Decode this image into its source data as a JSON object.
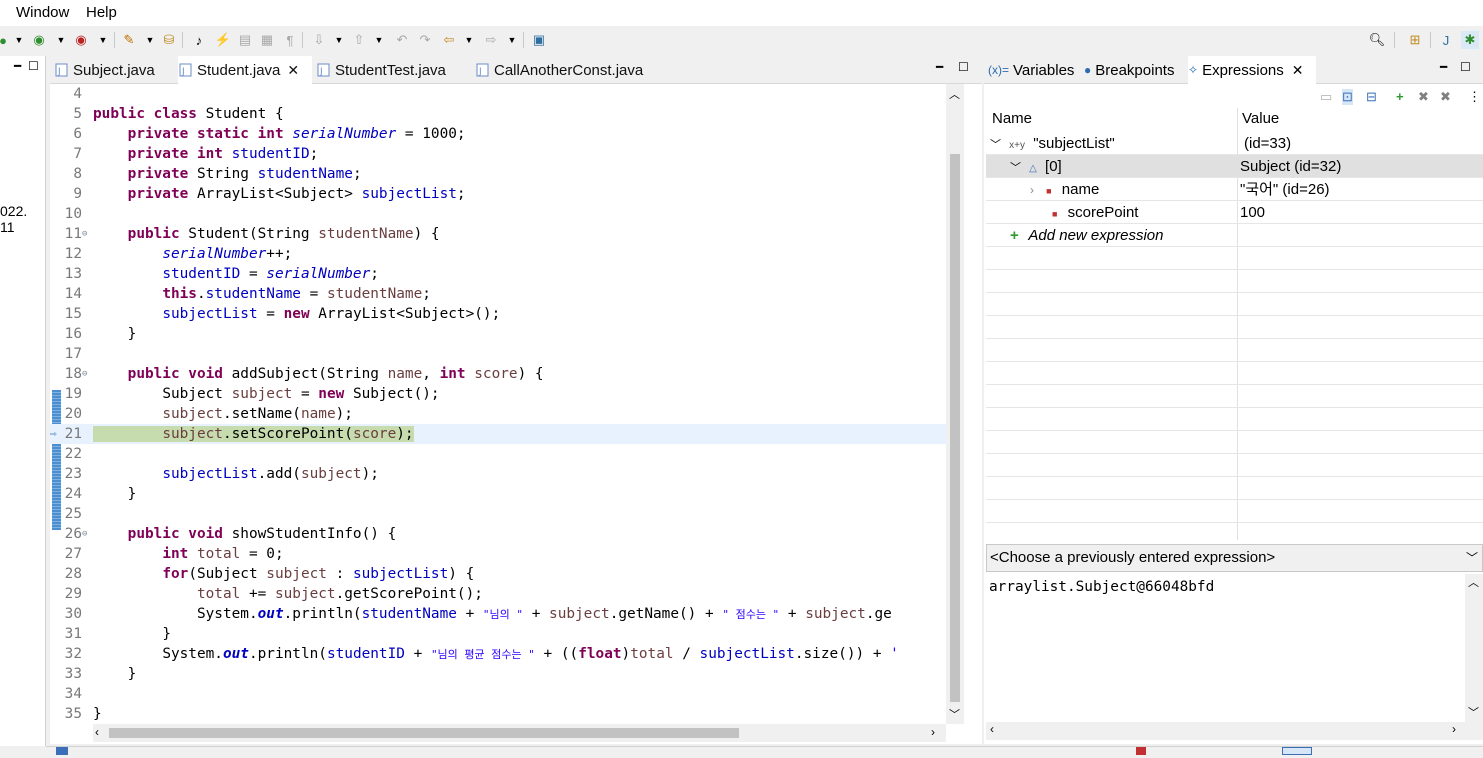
{
  "menu": {
    "items": [
      "Window",
      "Help"
    ]
  },
  "left_panel": {
    "date_fragment": "022. 11"
  },
  "editor": {
    "tabs": [
      {
        "label": "Subject.java",
        "active": false
      },
      {
        "label": "Student.java",
        "active": true
      },
      {
        "label": "StudentTest.java",
        "active": false
      },
      {
        "label": "CallAnotherConst.java",
        "active": false
      }
    ],
    "current_line": 21,
    "line_numbers": [
      "4",
      "5",
      "6",
      "7",
      "8",
      "9",
      "10",
      "11",
      "12",
      "13",
      "14",
      "15",
      "16",
      "17",
      "18",
      "19",
      "20",
      "21",
      "22",
      "23",
      "24",
      "25",
      "26",
      "27",
      "28",
      "29",
      "30",
      "31",
      "32",
      "33",
      "34",
      "35"
    ],
    "code": {
      "l5_kw": "public class",
      "l5_rest": " Student {",
      "l6_kw": "private static int",
      "l6_field": "serialNumber",
      "l6_rest": " = 1000;",
      "l7_kw": "private int",
      "l7_field": "studentID",
      "l7_rest": ";",
      "l8_kw": "private",
      "l8_type": " String ",
      "l8_field": "studentName",
      "l8_rest": ";",
      "l9_kw": "private",
      "l9_type": " ArrayList<Subject> ",
      "l9_field": "subjectList",
      "l9_rest": ";",
      "l11_kw": "public",
      "l11_sig": " Student(String ",
      "l11_param": "studentName",
      "l11_rest": ") {",
      "l12_field": "serialNumber",
      "l12_rest": "++;",
      "l13_field": "studentID",
      "l13_mid": " = ",
      "l13_sfield": "serialNumber",
      "l13_rest": ";",
      "l14_kw": "this",
      "l14_dot": ".",
      "l14_field": "studentName",
      "l14_mid": " = ",
      "l14_param": "studentName",
      "l14_rest": ";",
      "l15_field": "subjectList",
      "l15_mid": " = ",
      "l15_kw": "new",
      "l15_rest": " ArrayList<Subject>();",
      "l16": "}",
      "l18_kw": "public void",
      "l18_sig": " addSubject(String ",
      "l18_p1": "name",
      "l18_sep": ", ",
      "l18_kw2": "int",
      "l18_sp": " ",
      "l18_p2": "score",
      "l18_rest": ") {",
      "l19_type": "Subject ",
      "l19_local": "subject",
      "l19_mid": " = ",
      "l19_kw": "new",
      "l19_rest": " Subject();",
      "l20_local": "subject",
      "l20_mid": ".setName(",
      "l20_p": "name",
      "l20_rest": ");",
      "l21_local": "subject",
      "l21_mid": ".setScorePoint(",
      "l21_p": "score",
      "l21_rest": ");",
      "l23_field": "subjectList",
      "l23_mid": ".add(",
      "l23_local": "subject",
      "l23_rest": ");",
      "l24": "}",
      "l26_kw": "public void",
      "l26_rest": " showStudentInfo() {",
      "l27_kw": "int",
      "l27_sp": " ",
      "l27_local": "total",
      "l27_rest": " = 0;",
      "l28_kw": "for",
      "l28_a": "(Subject ",
      "l28_local": "subject",
      "l28_b": " : ",
      "l28_field": "subjectList",
      "l28_rest": ") {",
      "l29_local": "total",
      "l29_a": " += ",
      "l29_local2": "subject",
      "l29_rest": ".getScorePoint();",
      "l30_a": "System.",
      "l30_out": "out",
      "l30_b": ".println(",
      "l30_field": "studentName",
      "l30_c": " + ",
      "l30_s1": "\"님의 \"",
      "l30_d": " + ",
      "l30_local": "subject",
      "l30_e": ".getName() + ",
      "l30_s2": "\" 점수는 \"",
      "l30_f": " + ",
      "l30_local2": "subject",
      "l30_g": ".ge",
      "l31": "}",
      "l32_a": "System.",
      "l32_out": "out",
      "l32_b": ".println(",
      "l32_field": "studentID",
      "l32_c": " + ",
      "l32_s1": "\"님의 평균 점수는 \"",
      "l32_d": " + ((",
      "l32_kw": "float",
      "l32_e": ")",
      "l32_local": "total",
      "l32_f": " / ",
      "l32_field2": "subjectList",
      "l32_g": ".size()) + ",
      "l32_s2": "'",
      "l33": "}",
      "l35": "}"
    }
  },
  "right_panel": {
    "tabs": [
      {
        "label": "Variables",
        "icon": "variables-icon"
      },
      {
        "label": "Breakpoints",
        "icon": "breakpoints-icon"
      },
      {
        "label": "Expressions",
        "icon": "expressions-icon",
        "active": true
      }
    ],
    "table": {
      "headers": {
        "name": "Name",
        "value": "Value"
      },
      "rows": [
        {
          "name": "\"subjectList\"",
          "value": "(id=33)"
        },
        {
          "name": "[0]",
          "value": "Subject  (id=32)"
        },
        {
          "name": "name",
          "value": "\"국어\" (id=26)"
        },
        {
          "name": "scorePoint",
          "value": "100"
        }
      ],
      "add_expression": "Add new expression"
    },
    "combo": "<Choose a previously entered expression>",
    "detail": "arraylist.Subject@66048bfd"
  },
  "colors": {
    "keyword": "#7f0055",
    "field": "#0000c0",
    "local": "#6a3e3e",
    "string": "#2a00ff",
    "current_line": "#e8f2fe",
    "current_highlight": "#c6dbae"
  }
}
